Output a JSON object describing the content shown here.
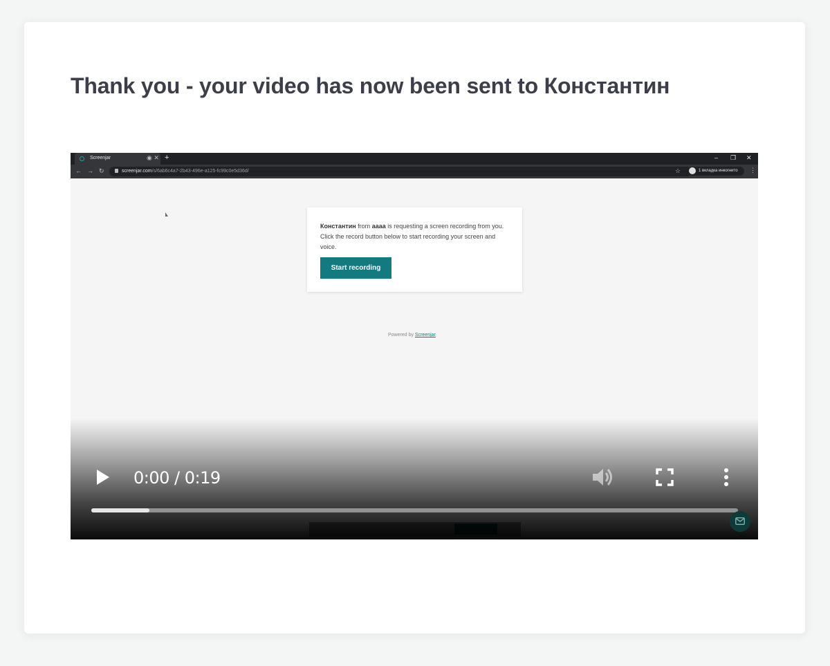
{
  "headline": {
    "prefix": "Thank you - your video has now been sent to ",
    "recipient": "Константин"
  },
  "video": {
    "browser": {
      "tab_title": "Screenjar",
      "new_tab": "+",
      "url_host": "screenjar.com",
      "url_path": "/s/6ab6c4a7-2b43-496e-a125-fc99c0e5d36d/",
      "incognito_label": "1 вкладка инкогнито",
      "window_controls": [
        "–",
        "❐",
        "✕"
      ]
    },
    "embedded_page": {
      "requester": "Константин",
      "from_word": " from ",
      "org": "aaaa",
      "message_rest": " is requesting a screen recording from you. Click the record button below to start recording your screen and voice.",
      "start_button": "Start recording",
      "powered_prefix": "Powered by ",
      "powered_link": "Screenjar"
    },
    "player": {
      "time_display": "0:00 / 0:19",
      "progress": 0.09
    }
  },
  "colors": {
    "accent": "#137b80",
    "text": "#3c3e49",
    "page_bg": "#f4f5f5"
  },
  "icons": [
    "play-icon",
    "volume-icon",
    "fullscreen-icon",
    "more-options-icon",
    "message-icon"
  ]
}
